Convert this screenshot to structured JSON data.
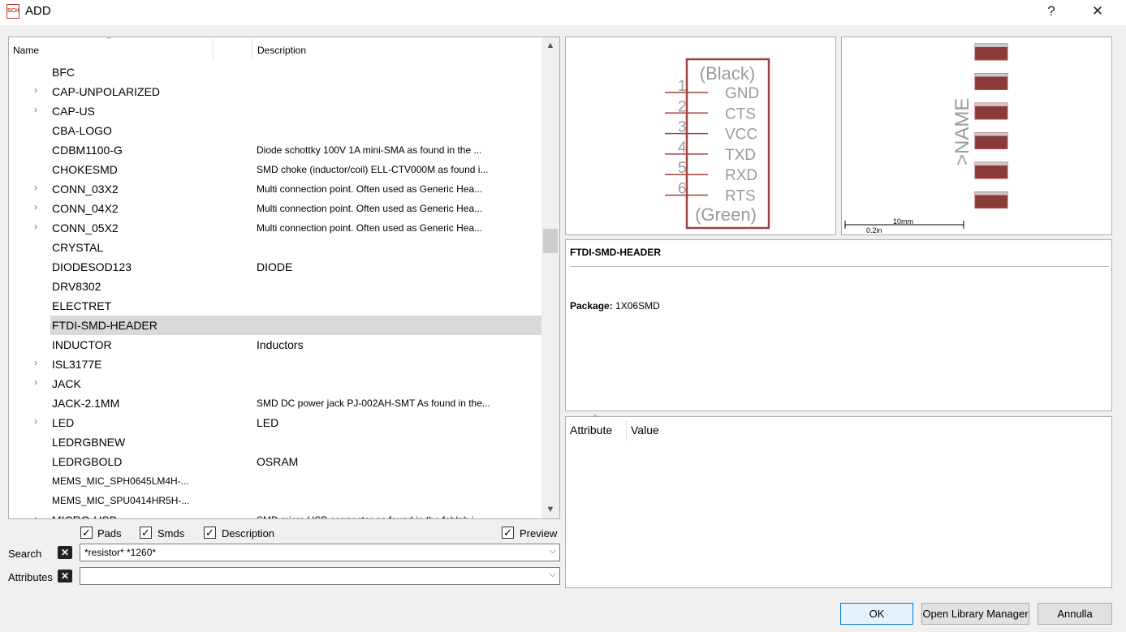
{
  "window": {
    "icon_text": "SCH",
    "title": "ADD",
    "help": "?",
    "close": "✕"
  },
  "tree": {
    "col_name": "Name",
    "col_desc": "Description",
    "sort_caret": "^",
    "scroll_up": "▲",
    "scroll_down": "▼",
    "rows": [
      {
        "name": "BFC",
        "desc": "",
        "expand": ""
      },
      {
        "name": "CAP-UNPOLARIZED",
        "desc": "",
        "expand": "›"
      },
      {
        "name": "CAP-US",
        "desc": "",
        "expand": "›"
      },
      {
        "name": "CBA-LOGO",
        "desc": "",
        "expand": ""
      },
      {
        "name": "CDBM1100-G",
        "desc": "Diode schottky 100V 1A mini-SMA as found in the ...",
        "expand": ""
      },
      {
        "name": "CHOKESMD",
        "desc": "SMD choke (inductor/coil) ELL-CTV000M as found i...",
        "expand": ""
      },
      {
        "name": "CONN_03X2",
        "desc": "Multi connection point. Often used as Generic Hea...",
        "expand": "›"
      },
      {
        "name": "CONN_04X2",
        "desc": "Multi connection point. Often used as Generic Hea...",
        "expand": "›"
      },
      {
        "name": "CONN_05X2",
        "desc": "Multi connection point. Often used as Generic Hea...",
        "expand": "›"
      },
      {
        "name": "CRYSTAL",
        "desc": "",
        "expand": ""
      },
      {
        "name": "DIODESOD123",
        "desc": "DIODE",
        "expand": ""
      },
      {
        "name": "DRV8302",
        "desc": "",
        "expand": ""
      },
      {
        "name": "ELECTRET",
        "desc": "",
        "expand": ""
      },
      {
        "name": "FTDI-SMD-HEADER",
        "desc": "",
        "expand": ""
      },
      {
        "name": "INDUCTOR",
        "desc": "Inductors",
        "expand": ""
      },
      {
        "name": "ISL3177E",
        "desc": "",
        "expand": "›"
      },
      {
        "name": "JACK",
        "desc": "",
        "expand": "›"
      },
      {
        "name": "JACK-2.1MM",
        "desc": "SMD DC power jack PJ-002AH-SMT As found in the...",
        "expand": ""
      },
      {
        "name": "LED",
        "desc": "LED",
        "expand": "›"
      },
      {
        "name": "LEDRGBNEW",
        "desc": "",
        "expand": ""
      },
      {
        "name": "LEDRGBOLD",
        "desc": "OSRAM",
        "expand": ""
      },
      {
        "name": "MEMS_MIC_SPH0645LM4H-...",
        "desc": "",
        "expand": ""
      },
      {
        "name": "MEMS_MIC_SPU0414HR5H-...",
        "desc": "",
        "expand": ""
      },
      {
        "name": "MICRO-USB",
        "desc": "SMD micro USB connector as found in the fablab i...",
        "expand": "›"
      }
    ]
  },
  "filters": {
    "pads": "Pads",
    "smds": "Smds",
    "description": "Description",
    "preview": "Preview",
    "check_mark": "✓"
  },
  "search": {
    "label": "Search",
    "value": "*resistor* *1260*",
    "clear": "✕",
    "dropdown": "⌵"
  },
  "attributes_filter": {
    "label": "Attributes",
    "value": "",
    "clear": "✕",
    "dropdown": "⌵"
  },
  "symbol": {
    "top_label": "(Black)",
    "bottom_label": "(Green)",
    "pins": [
      {
        "num": "1",
        "name": "GND"
      },
      {
        "num": "2",
        "name": "CTS"
      },
      {
        "num": "3",
        "name": "VCC"
      },
      {
        "num": "4",
        "name": "TXD"
      },
      {
        "num": "5",
        "name": "RXD"
      },
      {
        "num": "6",
        "name": "RTS"
      }
    ],
    "line_color": "#a0413e",
    "text_color": "#9a9a9a"
  },
  "package": {
    "name_label": ">NAME",
    "scale_mm": "10mm",
    "scale_in": "0.2in",
    "pad_color": "#8b3a3a",
    "pad_count": 6
  },
  "info": {
    "title": "FTDI-SMD-HEADER",
    "package_label": "Package:",
    "package_value": "1X06SMD"
  },
  "attributes": {
    "col_attribute": "Attribute",
    "col_value": "Value",
    "sort_caret": "^"
  },
  "buttons": {
    "ok": "OK",
    "library_manager": "Open Library Manager",
    "cancel": "Annulla"
  }
}
